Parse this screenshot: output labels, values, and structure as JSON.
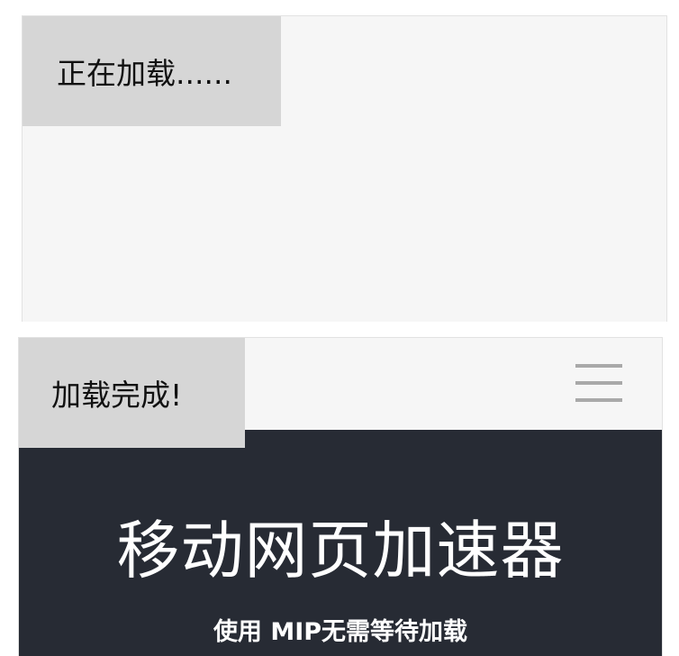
{
  "loading_panel": {
    "status_text": "正在加载......"
  },
  "loaded_panel": {
    "status_text": "加载完成!",
    "menu_icon": "hamburger-menu-icon",
    "hero": {
      "title": "移动网页加速器",
      "subtitle": "使用 MIP无需等待加载"
    }
  },
  "colors": {
    "panel_bg": "#f6f6f6",
    "badge_bg": "#d6d6d6",
    "hero_bg": "#272b34",
    "hero_text": "#ffffff",
    "menu_icon": "#a9a9a9"
  }
}
